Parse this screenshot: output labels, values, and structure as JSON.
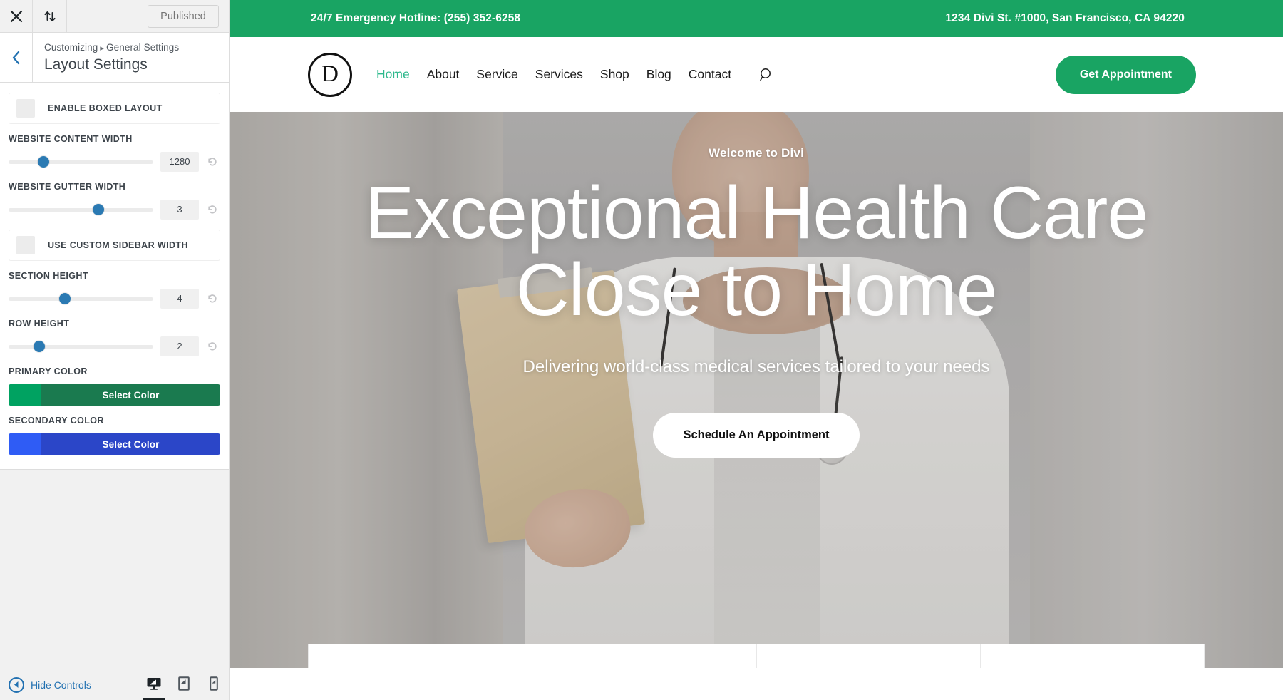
{
  "customizer": {
    "topbar": {
      "close_icon": "close-icon",
      "devices_icon": "collapse-arrows-icon",
      "published_label": "Published"
    },
    "header": {
      "back_icon": "chevron-left-icon",
      "breadcrumb_root": "Customizing",
      "breadcrumb_separator": "▸",
      "breadcrumb_section": "General Settings",
      "panel_title": "Layout Settings"
    },
    "controls": [
      {
        "type": "toggle",
        "label": "ENABLE BOXED LAYOUT",
        "checked": false
      },
      {
        "type": "range",
        "label": "WEBSITE CONTENT WIDTH",
        "value": "1280",
        "thumb_pct": 24
      },
      {
        "type": "range",
        "label": "WEBSITE GUTTER WIDTH",
        "value": "3",
        "thumb_pct": 62
      },
      {
        "type": "toggle",
        "label": "USE CUSTOM SIDEBAR WIDTH",
        "checked": false
      },
      {
        "type": "range",
        "label": "SECTION HEIGHT",
        "value": "4",
        "thumb_pct": 39
      },
      {
        "type": "range",
        "label": "ROW HEIGHT",
        "value": "2",
        "thumb_pct": 21
      },
      {
        "type": "color",
        "label": "PRIMARY COLOR",
        "button_label": "Select Color",
        "swatch": "#00a261",
        "button_bg": "#1a7a4f"
      },
      {
        "type": "color",
        "label": "SECONDARY COLOR",
        "button_label": "Select Color",
        "swatch": "#2f5cf5",
        "button_bg": "#2b46c8"
      }
    ],
    "footer": {
      "hide_controls_label": "Hide Controls",
      "devices": [
        {
          "name": "desktop",
          "active": true
        },
        {
          "name": "tablet",
          "active": false
        },
        {
          "name": "mobile",
          "active": false
        }
      ]
    },
    "reset_icon": "reset-icon"
  },
  "site": {
    "topbar": {
      "bg": "#19a463",
      "hotline": "24/7 Emergency Hotline: (255) 352-6258",
      "address": "1234 Divi St. #1000, San Francisco, CA 94220"
    },
    "nav": {
      "logo_letter": "D",
      "links": [
        {
          "label": "Home",
          "active": true
        },
        {
          "label": "About",
          "active": false
        },
        {
          "label": "Service",
          "active": false
        },
        {
          "label": "Services",
          "active": false
        },
        {
          "label": "Shop",
          "active": false
        },
        {
          "label": "Blog",
          "active": false
        },
        {
          "label": "Contact",
          "active": false
        }
      ],
      "search_icon": "search-icon",
      "cta_label": "Get Appointment",
      "cta_bg": "#19a463",
      "active_link_color": "#2fb98d"
    },
    "hero": {
      "eyebrow": "Welcome to Divi",
      "title": "Exceptional Health Care Close to Home",
      "subtitle": "Delivering world-class medical services tailored to your needs",
      "button_label": "Schedule An Appointment"
    }
  }
}
